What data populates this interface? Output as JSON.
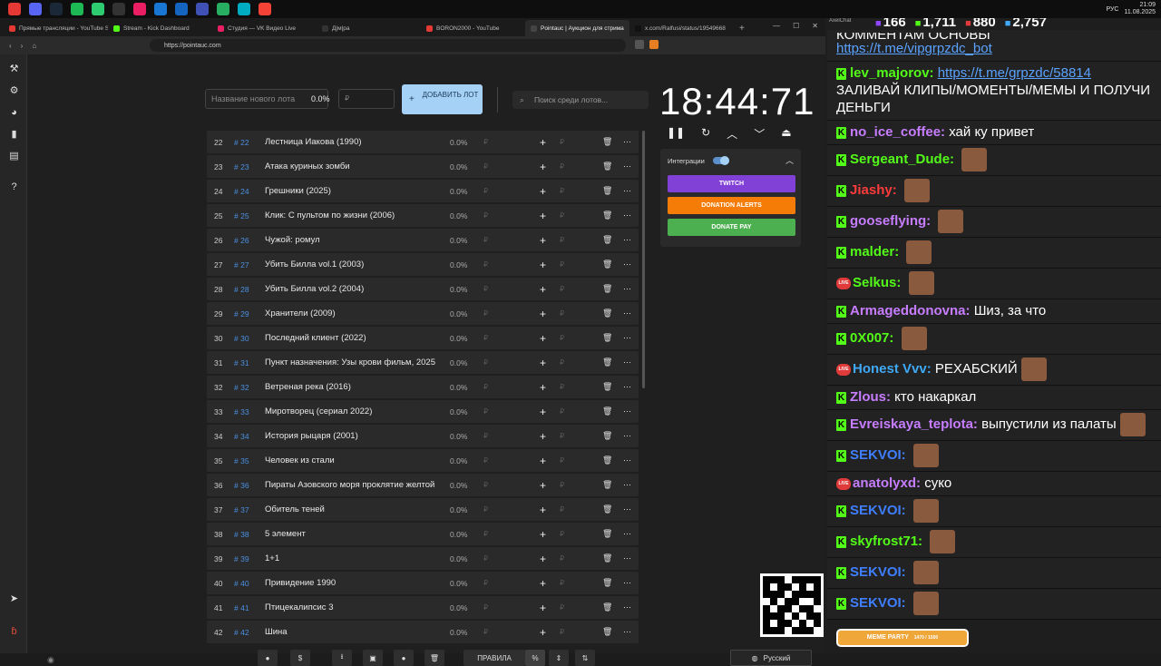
{
  "taskbar": {
    "icons": [
      "#e53935",
      "#5865f2",
      "#1b2838",
      "#1db954",
      "#2ecc71",
      "#333",
      "#e91e63",
      "#1976d2",
      "#1565c0",
      "#3f51b5",
      "#27ae60",
      "#00acc1",
      "#f44336"
    ],
    "lang": "РУС",
    "time": "21:09",
    "date": "11.08.2025"
  },
  "browser": {
    "tabs": [
      {
        "label": "Прямые трансляции - YouTube Studio",
        "color": "#e53935",
        "active": false
      },
      {
        "label": "Stream - Kick Dashboard",
        "color": "#53fc18",
        "active": false
      },
      {
        "label": "Студия — VK Видео Live",
        "color": "#e91e63",
        "active": false
      },
      {
        "label": "Д|м|ра",
        "color": "#333",
        "active": false
      },
      {
        "label": "BORON2000 - YouTube",
        "color": "#e53935",
        "active": false
      },
      {
        "label": "Pointauc | Аукцион для стрима",
        "color": "#444",
        "active": true
      },
      {
        "label": "x.com/Ralfusi/status/19549668",
        "color": "#111",
        "active": false
      }
    ],
    "url": "https://pointauc.com"
  },
  "form": {
    "lot_placeholder": "Название нового лота",
    "pct": "0.0%",
    "rub": "₽",
    "add_btn": "ДОБАВИТЬ ЛОТ",
    "search_placeholder": "Поиск среди лотов..."
  },
  "lots": [
    {
      "idx": "22",
      "hash": "# 22",
      "name": "Лестница Иакова (1990)",
      "pct": "0.0%"
    },
    {
      "idx": "23",
      "hash": "# 23",
      "name": "Атака куриных зомби",
      "pct": "0.0%"
    },
    {
      "idx": "24",
      "hash": "# 24",
      "name": "Грешники (2025)",
      "pct": "0.0%"
    },
    {
      "idx": "25",
      "hash": "# 25",
      "name": "Клик: С пультом по жизни (2006)",
      "pct": "0.0%"
    },
    {
      "idx": "26",
      "hash": "# 26",
      "name": "Чужой: ромул",
      "pct": "0.0%"
    },
    {
      "idx": "27",
      "hash": "# 27",
      "name": "Убить Билла vol.1 (2003)",
      "pct": "0.0%"
    },
    {
      "idx": "28",
      "hash": "# 28",
      "name": "Убить Билла vol.2 (2004)",
      "pct": "0.0%"
    },
    {
      "idx": "29",
      "hash": "# 29",
      "name": "Хранители (2009)",
      "pct": "0.0%"
    },
    {
      "idx": "30",
      "hash": "# 30",
      "name": "Последний клиент (2022)",
      "pct": "0.0%"
    },
    {
      "idx": "31",
      "hash": "# 31",
      "name": "Пункт назначения: Узы крови фильм, 2025",
      "pct": "0.0%"
    },
    {
      "idx": "32",
      "hash": "# 32",
      "name": "Ветреная река (2016)",
      "pct": "0.0%"
    },
    {
      "idx": "33",
      "hash": "# 33",
      "name": "Миротворец (сериал 2022)",
      "pct": "0.0%"
    },
    {
      "idx": "34",
      "hash": "# 34",
      "name": "История рыцаря (2001)",
      "pct": "0.0%"
    },
    {
      "idx": "35",
      "hash": "# 35",
      "name": "Человек из стали",
      "pct": "0.0%"
    },
    {
      "idx": "36",
      "hash": "# 36",
      "name": "Пираты Азовского моря проклятие желтой",
      "pct": "0.0%"
    },
    {
      "idx": "37",
      "hash": "# 37",
      "name": "Обитель теней",
      "pct": "0.0%"
    },
    {
      "idx": "38",
      "hash": "# 38",
      "name": "5 элемент",
      "pct": "0.0%"
    },
    {
      "idx": "39",
      "hash": "# 39",
      "name": " 1+1",
      "pct": "0.0%"
    },
    {
      "idx": "40",
      "hash": "# 40",
      "name": "Привидение 1990",
      "pct": "0.0%"
    },
    {
      "idx": "41",
      "hash": "# 41",
      "name": "Птицекалипсис 3",
      "pct": "0.0%"
    },
    {
      "idx": "42",
      "hash": "# 42",
      "name": "Шина",
      "pct": "0.0%"
    }
  ],
  "timer": {
    "value": "18:44:71"
  },
  "integrations": {
    "label": "Интеграции",
    "twitch": "TWITCH",
    "donation": "DONATION ALERTS",
    "donatepay": "DONATE PAY"
  },
  "bottom": {
    "rules": "ПРАВИЛА",
    "lang": "Русский"
  },
  "chat": {
    "app": "AxelChat",
    "stats": [
      "166",
      "1,711",
      "880",
      "2,757"
    ],
    "messages": [
      {
        "badge": "",
        "nick": "",
        "nickColor": "#fff",
        "text": "КОММЕНТАМ ОСНОВЫ",
        "link": "https://t.me/vipgrpzdc_bot",
        "emote": false
      },
      {
        "badge": "k",
        "nick": "lev_majorov:",
        "nickColor": "#53fc18",
        "text": "",
        "link": "https://t.me/grpzdc/58814",
        "after": "ЗАЛИВАЙ КЛИПЫ/МОМЕНТЫ/МЕМЫ И ПОЛУЧИ ДЕНЬГИ",
        "emote": false
      },
      {
        "badge": "k",
        "nick": "no_ice_coffee:",
        "nickColor": "#c77dff",
        "text": "хай ку привет",
        "emote": false
      },
      {
        "badge": "k",
        "nick": "Sergeant_Dude:",
        "nickColor": "#53fc18",
        "text": "",
        "emote": true
      },
      {
        "badge": "k",
        "nick": "Jiashy:",
        "nickColor": "#ff3b3b",
        "text": "",
        "emote": true
      },
      {
        "badge": "k",
        "nick": "gooseflying:",
        "nickColor": "#c77dff",
        "text": "",
        "emote": true
      },
      {
        "badge": "k",
        "nick": "malder:",
        "nickColor": "#53fc18",
        "text": "",
        "emote": true
      },
      {
        "badge": "live",
        "nick": "Selkus:",
        "nickColor": "#53fc18",
        "text": "",
        "emote": true
      },
      {
        "badge": "k",
        "nick": "Armageddonovna:",
        "nickColor": "#c77dff",
        "text": "Шиз, за что",
        "emote": false
      },
      {
        "badge": "k",
        "nick": "0X007:",
        "nickColor": "#53fc18",
        "text": "",
        "emote": true
      },
      {
        "badge": "live",
        "nick": "Honest Vvv:",
        "nickColor": "#3fa9f5",
        "text": "РЕХАБСКИЙ",
        "emote": true
      },
      {
        "badge": "k",
        "nick": "Zlous:",
        "nickColor": "#c77dff",
        "text": "кто накаркал",
        "emote": false
      },
      {
        "badge": "k",
        "nick": "Evreiskaya_teplota:",
        "nickColor": "#c77dff",
        "text": "выпустили из палаты",
        "emote": true
      },
      {
        "badge": "k",
        "nick": "SEKVOI:",
        "nickColor": "#3f7fff",
        "text": "",
        "emote": true
      },
      {
        "badge": "live",
        "nick": "anatolyxd:",
        "nickColor": "#c77dff",
        "text": "суко",
        "emote": false
      },
      {
        "badge": "k",
        "nick": "SEKVOI:",
        "nickColor": "#3f7fff",
        "text": "",
        "emote": true
      },
      {
        "badge": "k",
        "nick": "skyfrost71:",
        "nickColor": "#53fc18",
        "text": "",
        "emote": true
      },
      {
        "badge": "k",
        "nick": "SEKVOI:",
        "nickColor": "#3f7fff",
        "text": "",
        "emote": true
      },
      {
        "badge": "k",
        "nick": "SEKVOI:",
        "nickColor": "#3f7fff",
        "text": "",
        "emote": true
      }
    ],
    "meme_party": "MEME PARTY",
    "meme_progress": "1470 / 1500"
  }
}
